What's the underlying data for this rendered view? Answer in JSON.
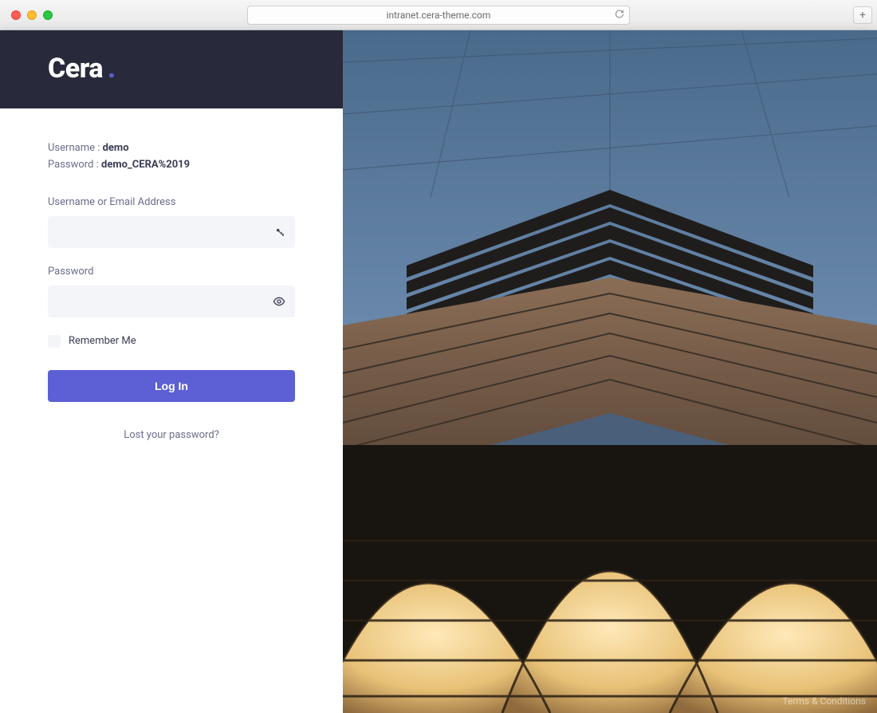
{
  "browser": {
    "url": "intranet.cera-theme.com"
  },
  "brand": {
    "name": "Cera",
    "dot": "."
  },
  "demo": {
    "username_label": "Username : ",
    "username_value": "demo",
    "password_label": "Password : ",
    "password_value": "demo_CERA%2019"
  },
  "form": {
    "username_label": "Username or Email Address",
    "password_label": "Password",
    "remember_label": "Remember Me",
    "login_button": "Log In",
    "lost_password": "Lost your password?"
  },
  "footer": {
    "terms": "Terms & Conditions"
  },
  "colors": {
    "accent": "#5d5fd4",
    "header_bg": "#282a3c",
    "input_bg": "#f4f5f8"
  }
}
